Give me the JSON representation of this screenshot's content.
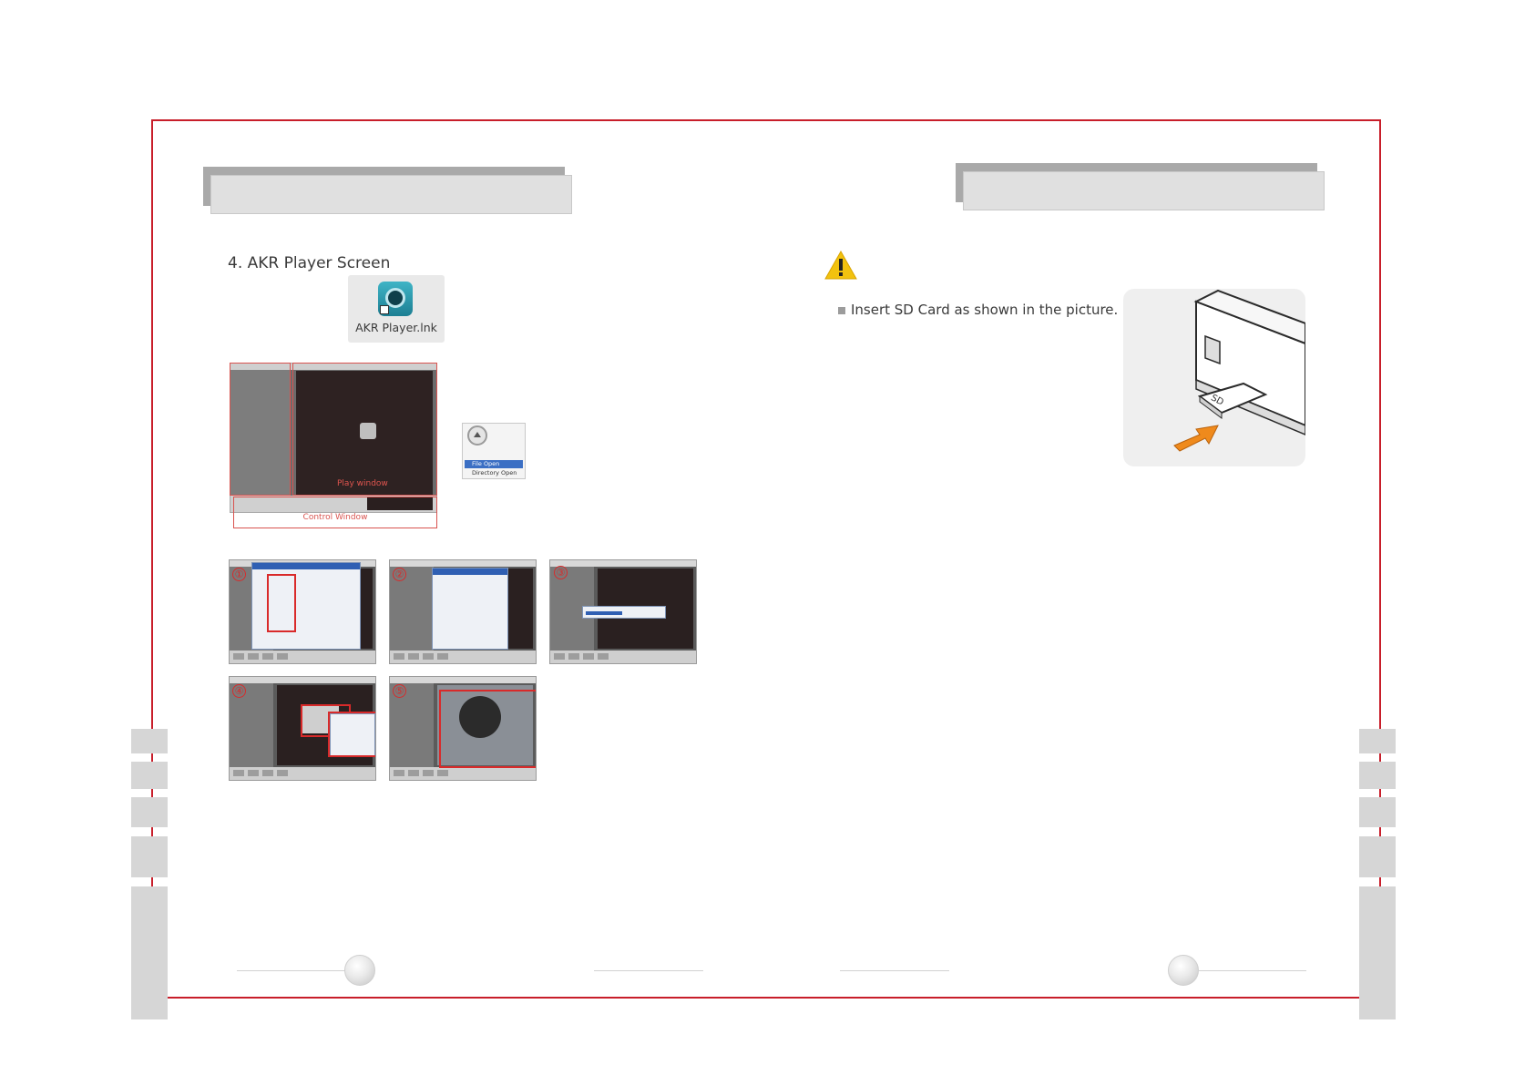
{
  "colors": {
    "frame": "#c81e2a",
    "header": "#e0e0e0",
    "tab": "#d6d6d6",
    "warning": "#f2c20f",
    "arrow": "#ef8a1c"
  },
  "left_page": {
    "section_title": "4. AKR Player Screen",
    "shortcut_label": "AKR Player.lnk",
    "player_labels": {
      "play_window": "Play window",
      "control_window": "Control Window"
    },
    "open_menu": {
      "items": [
        "File Open",
        "Directory Open"
      ]
    },
    "steps": [
      "①",
      "②",
      "③",
      "④",
      "⑤"
    ]
  },
  "right_page": {
    "warning_icon": "warning-triangle-icon",
    "instruction": "Insert SD Card as shown in the picture.",
    "card_label": "SD"
  }
}
